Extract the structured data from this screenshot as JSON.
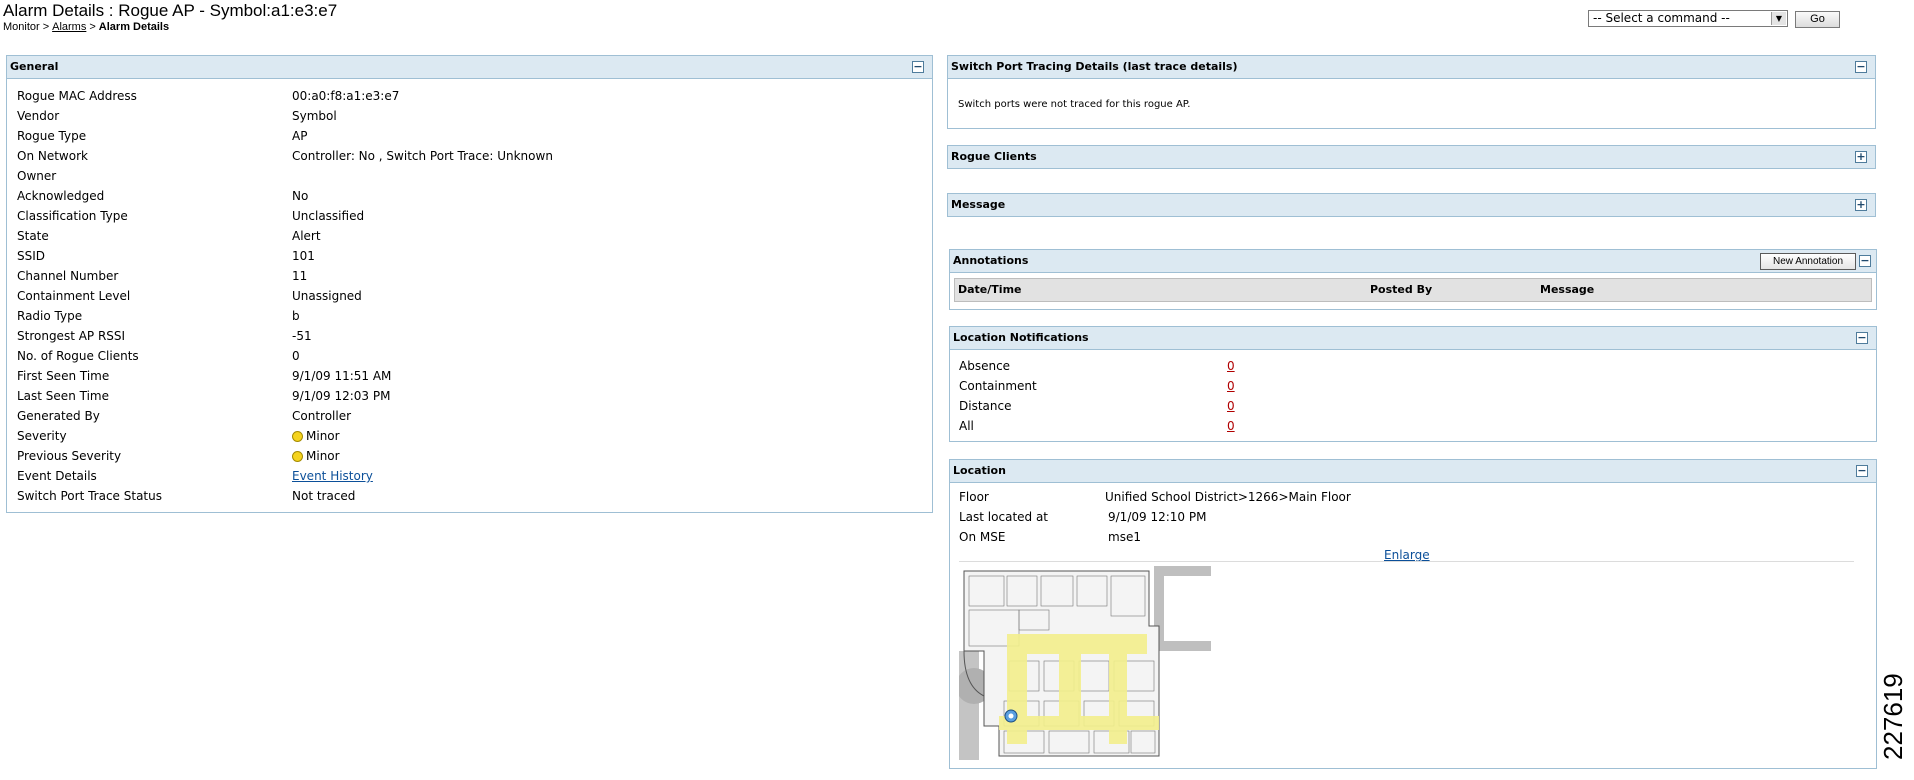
{
  "header": {
    "title": "Alarm Details : Rogue AP - Symbol:a1:e3:e7",
    "breadcrumb": {
      "root": "Monitor",
      "sep": ">",
      "alarms": "Alarms",
      "current": "Alarm Details"
    },
    "command_select": "-- Select a command --",
    "go_label": "Go"
  },
  "general": {
    "title": "General",
    "toggle": "−",
    "rows": [
      {
        "label": "Rogue MAC Address",
        "value": "00:a0:f8:a1:e3:e7"
      },
      {
        "label": "Vendor",
        "value": "Symbol"
      },
      {
        "label": "Rogue Type",
        "value": "AP"
      },
      {
        "label": "On Network",
        "value": "Controller: No ,  Switch Port Trace: Unknown"
      },
      {
        "label": "Owner",
        "value": ""
      },
      {
        "label": "Acknowledged",
        "value": "No"
      },
      {
        "label": "Classification Type",
        "value": "Unclassified"
      },
      {
        "label": "State",
        "value": "Alert"
      },
      {
        "label": "SSID",
        "value": "101"
      },
      {
        "label": "Channel Number",
        "value": "11"
      },
      {
        "label": "Containment Level",
        "value": "Unassigned"
      },
      {
        "label": "Radio Type",
        "value": "b"
      },
      {
        "label": "Strongest AP RSSI",
        "value": "-51"
      },
      {
        "label": "No. of Rogue Clients",
        "value": "0"
      },
      {
        "label": "First Seen Time",
        "value": "9/1/09 11:51 AM"
      },
      {
        "label": "Last Seen Time",
        "value": "9/1/09 12:03 PM"
      },
      {
        "label": "Generated By",
        "value": "Controller"
      },
      {
        "label": "Severity",
        "value": "Minor"
      },
      {
        "label": "Previous Severity",
        "value": "Minor"
      },
      {
        "label": "Event Details",
        "value": "Event History"
      },
      {
        "label": "Switch Port Trace Status",
        "value": "Not traced"
      }
    ]
  },
  "switch_port": {
    "title": "Switch Port Tracing Details (last trace details)",
    "toggle": "−",
    "message": "Switch ports were not traced for this rogue AP."
  },
  "rogue_clients": {
    "title": "Rogue Clients",
    "toggle": "+"
  },
  "message_panel": {
    "title": "Message",
    "toggle": "+"
  },
  "annotations": {
    "title": "Annotations",
    "toggle": "−",
    "new_button": "New Annotation",
    "columns": [
      "Date/Time",
      "Posted By",
      "Message"
    ]
  },
  "location_notifications": {
    "title": "Location Notifications",
    "toggle": "−",
    "rows": [
      {
        "label": "Absence",
        "value": "0"
      },
      {
        "label": "Containment",
        "value": "0"
      },
      {
        "label": "Distance",
        "value": "0"
      },
      {
        "label": "All",
        "value": "0"
      }
    ]
  },
  "location": {
    "title": "Location",
    "toggle": "−",
    "floor_label": "Floor",
    "floor_value": "Unified School District>1266>Main Floor",
    "last_located_label": "Last located at",
    "last_located_value": "9/1/09 12:10 PM",
    "mse_label": "On MSE",
    "mse_value": "mse1",
    "enlarge": "Enlarge"
  },
  "figure_id": "227619",
  "colors": {
    "panel_header": "#dce9f2",
    "panel_border": "#9fbfd4",
    "severity_minor": "#f5d31d",
    "link": "#0b4f99"
  }
}
